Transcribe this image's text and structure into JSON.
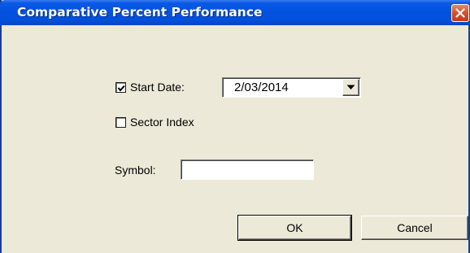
{
  "window": {
    "title": "Comparative Percent Performance",
    "close_icon": "close-icon",
    "title_bar_color": "#0352e0",
    "close_button_color": "#d84f2c"
  },
  "form": {
    "start_date": {
      "label": "Start Date:",
      "checked": true,
      "value": "2/03/2014"
    },
    "sector_index": {
      "label": "Sector Index",
      "checked": false
    },
    "symbol": {
      "label": "Symbol:",
      "value": "",
      "placeholder": ""
    }
  },
  "buttons": {
    "ok_label": "OK",
    "cancel_label": "Cancel"
  }
}
